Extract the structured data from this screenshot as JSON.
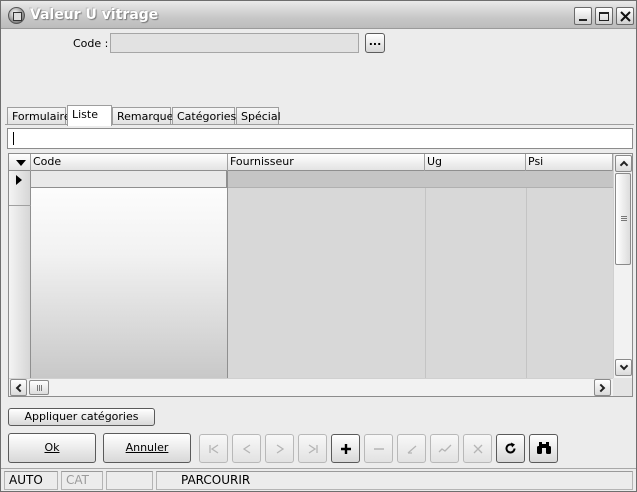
{
  "window": {
    "title": "Valeur U vitrage",
    "controls": [
      "minimize-icon",
      "maximize-icon",
      "close-icon"
    ]
  },
  "code_field": {
    "label": "Code :",
    "value": "",
    "browse_label": "..."
  },
  "tabs": [
    {
      "label": "Formulaire",
      "active": false
    },
    {
      "label": "Liste",
      "active": true
    },
    {
      "label": "Remarque",
      "active": false
    },
    {
      "label": "Catégories",
      "active": false
    },
    {
      "label": "Spécial",
      "active": false
    }
  ],
  "filter": {
    "value": ""
  },
  "grid": {
    "columns": [
      "Code",
      "Fournisseur",
      "Ug",
      "Psi"
    ],
    "rows": [
      {
        "Code": "",
        "Fournisseur": "",
        "Ug": "",
        "Psi": ""
      }
    ]
  },
  "buttons": {
    "apply_categories": "Appliquer catégories",
    "ok": "Ok",
    "cancel": "Annuler"
  },
  "navigator": [
    {
      "icon": "first-record-icon",
      "enabled": false
    },
    {
      "icon": "prior-record-icon",
      "enabled": false
    },
    {
      "icon": "next-record-icon",
      "enabled": false
    },
    {
      "icon": "last-record-icon",
      "enabled": false
    },
    {
      "icon": "insert-record-icon",
      "enabled": true
    },
    {
      "icon": "delete-record-icon",
      "enabled": false
    },
    {
      "icon": "edit-record-icon",
      "enabled": false
    },
    {
      "icon": "post-edit-icon",
      "enabled": false
    },
    {
      "icon": "cancel-edit-icon",
      "enabled": false
    },
    {
      "icon": "refresh-icon",
      "enabled": true
    },
    {
      "icon": "search-binoculars-icon",
      "enabled": true
    }
  ],
  "status": {
    "mode1": "AUTO",
    "mode2": "CAT",
    "state": "PARCOURIR"
  }
}
